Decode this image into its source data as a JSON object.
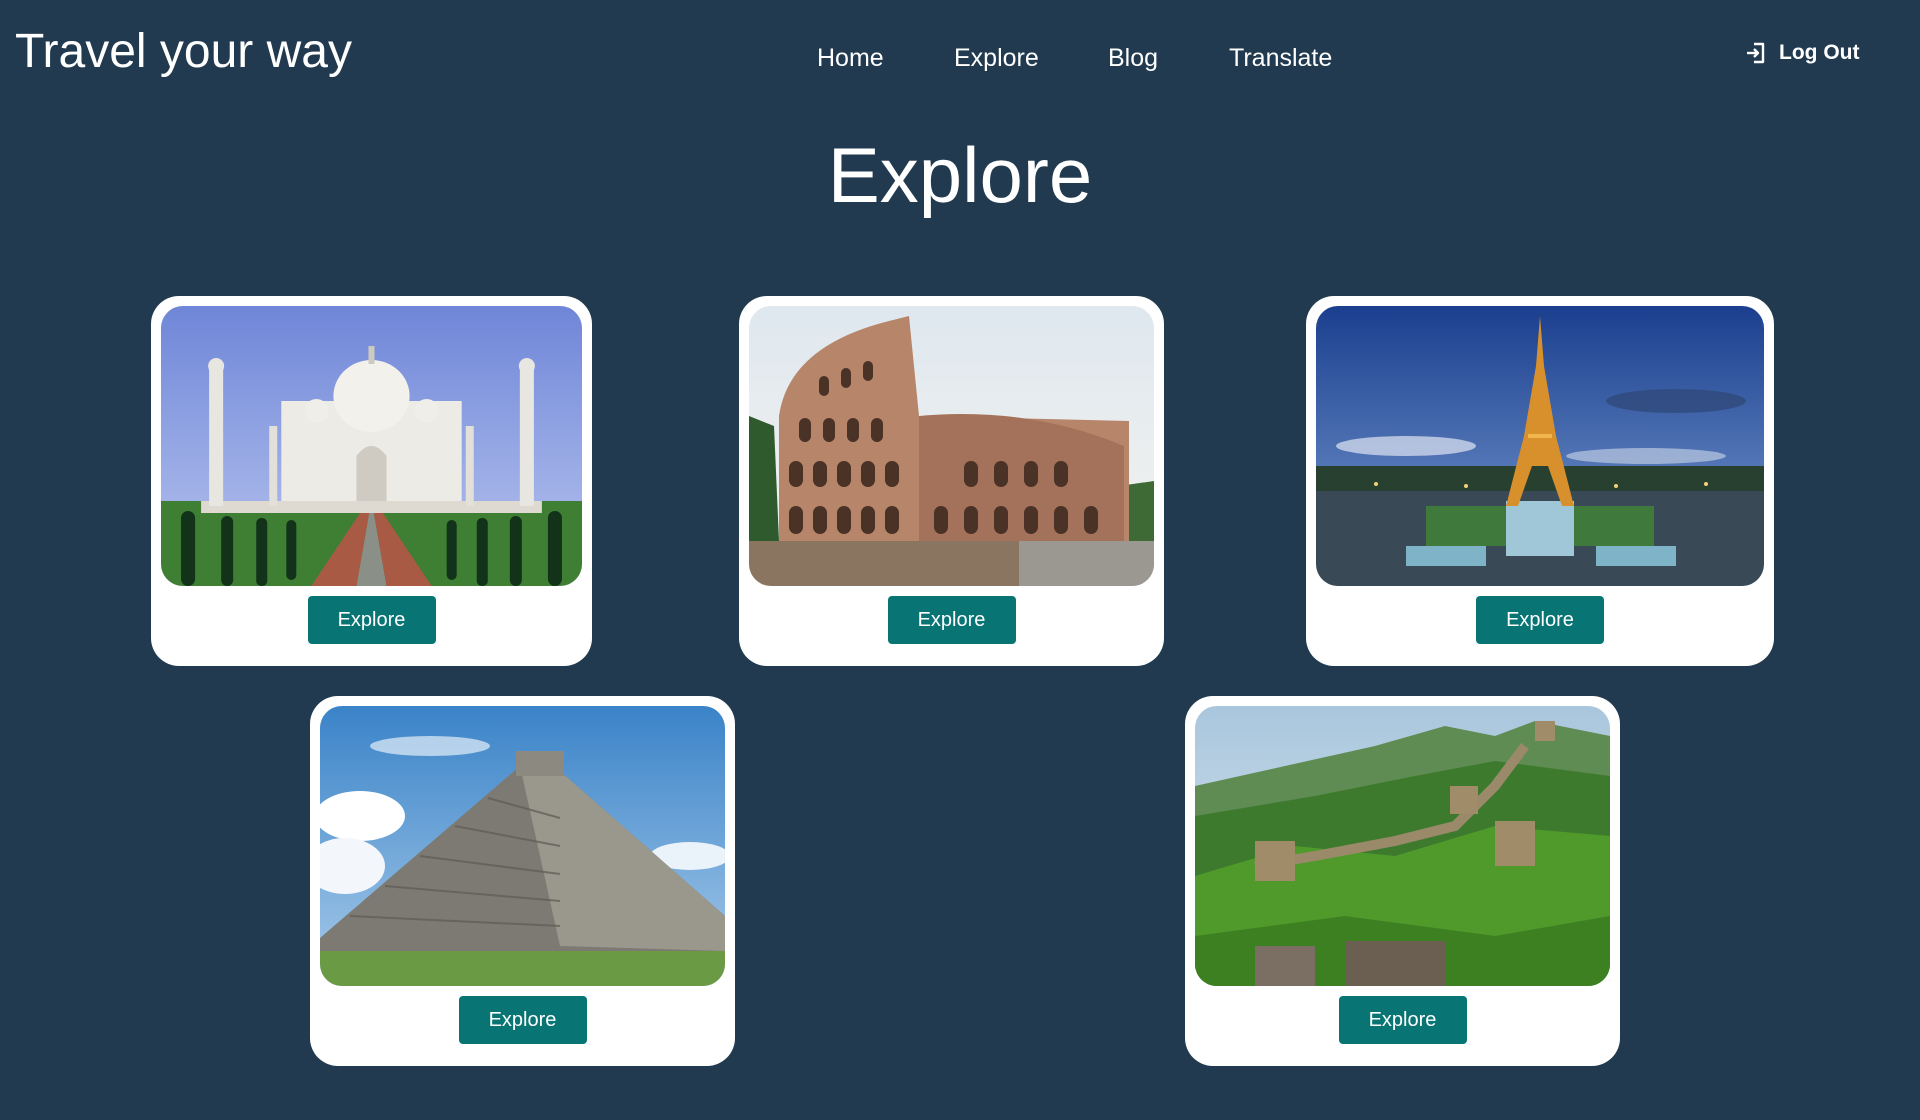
{
  "header": {
    "brand": "Travel your way",
    "nav": [
      {
        "label": "Home"
      },
      {
        "label": "Explore"
      },
      {
        "label": "Blog"
      },
      {
        "label": "Translate"
      }
    ],
    "logout_label": "Log Out",
    "logout_icon": "log-in-arrow-icon"
  },
  "main": {
    "title": "Explore",
    "cards": [
      {
        "photo": "taj-mahal-photo",
        "button_label": "Explore"
      },
      {
        "photo": "colosseum-photo",
        "button_label": "Explore"
      },
      {
        "photo": "eiffel-tower-photo",
        "button_label": "Explore"
      },
      {
        "photo": "chichen-itza-pyramid-photo",
        "button_label": "Explore"
      },
      {
        "photo": "great-wall-photo",
        "button_label": "Explore"
      }
    ]
  },
  "colors": {
    "background": "#213a4f",
    "card": "#ffffff",
    "button": "#087474",
    "text": "#ffffff"
  }
}
